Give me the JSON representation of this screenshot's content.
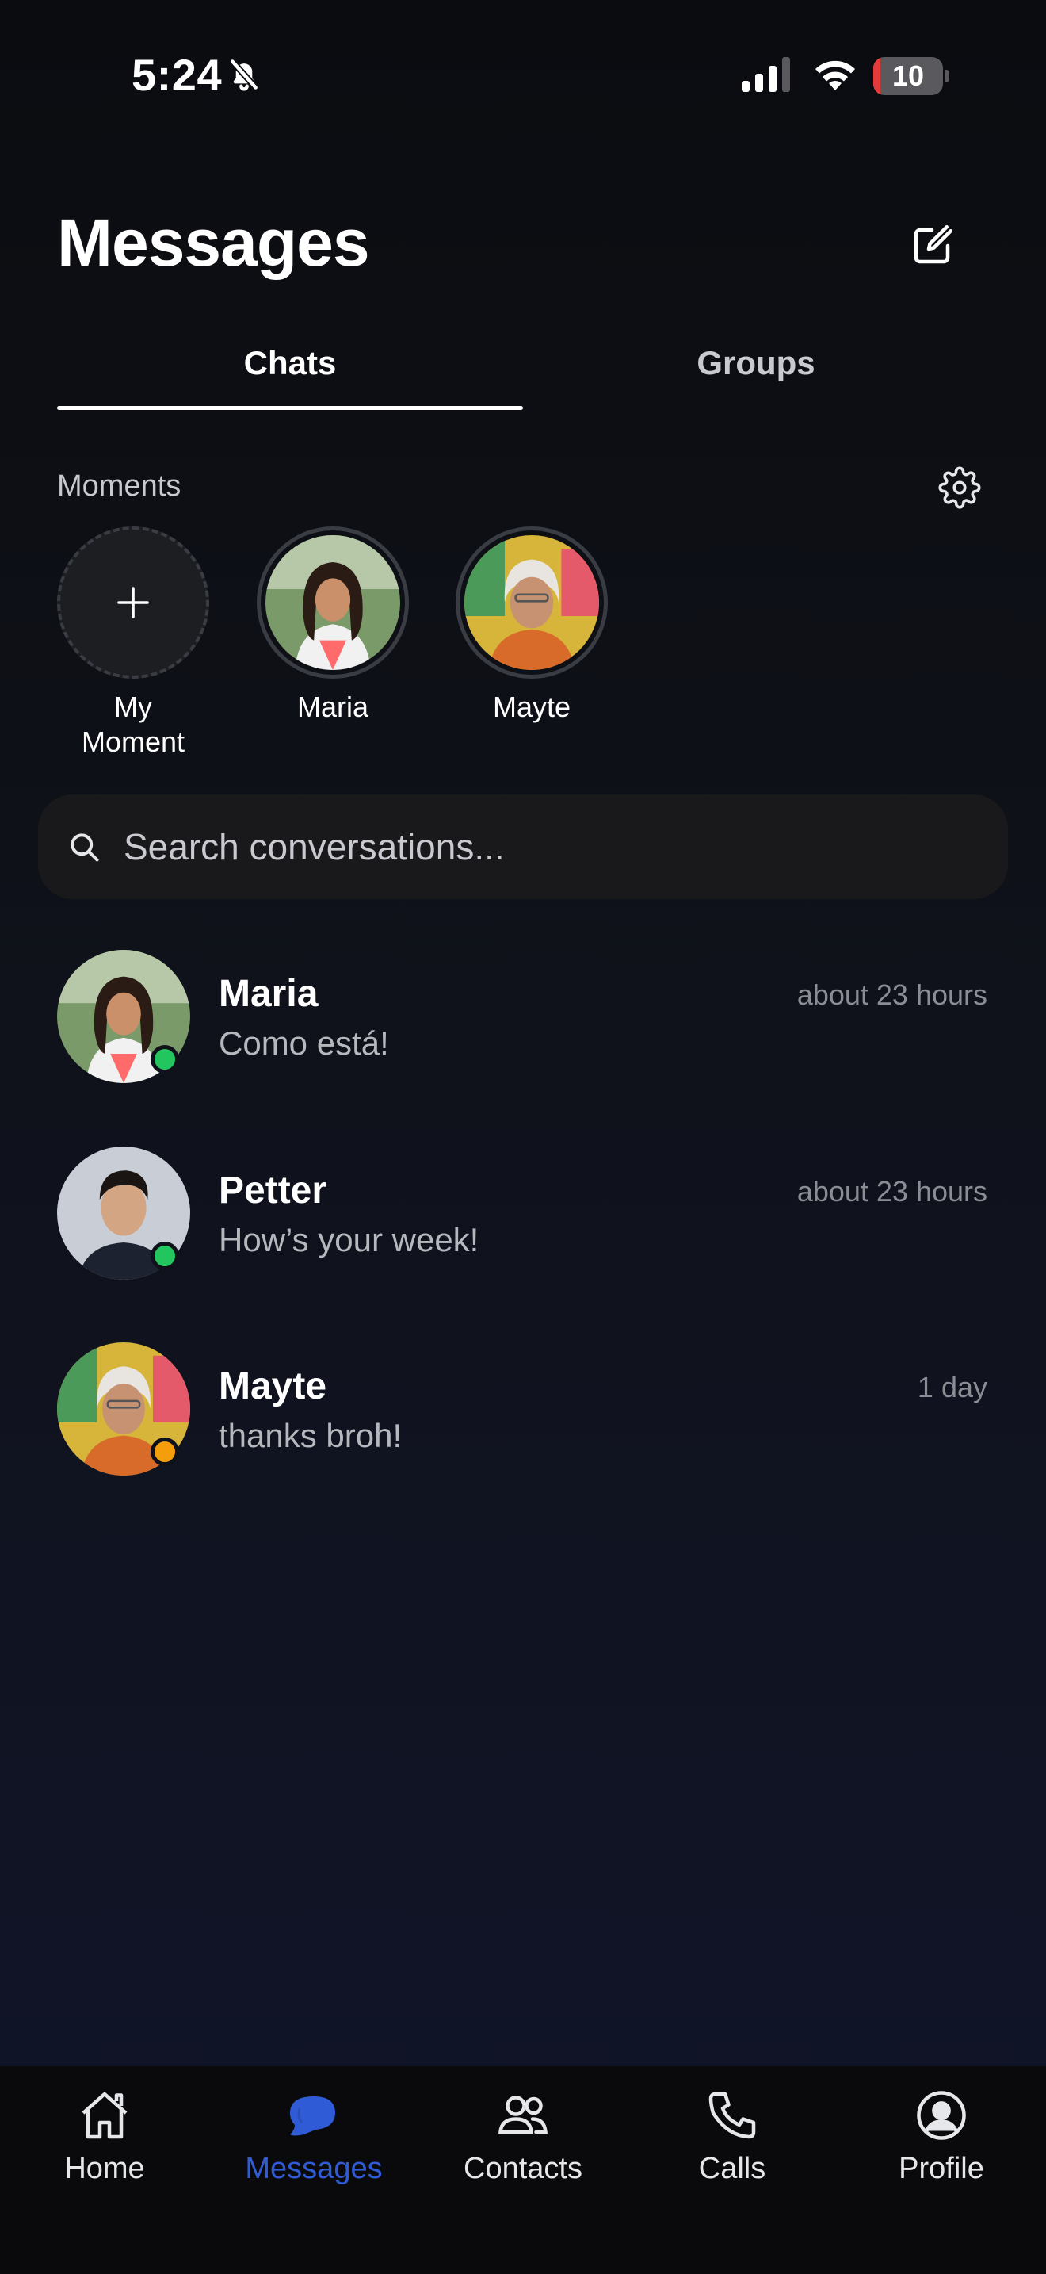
{
  "status_bar": {
    "time": "5:24",
    "battery_level": "10",
    "battery_fraction": 0.1
  },
  "header": {
    "title": "Messages",
    "compose_icon": "compose-icon"
  },
  "tabs": [
    {
      "label": "Chats",
      "active": true
    },
    {
      "label": "Groups",
      "active": false
    }
  ],
  "moments": {
    "label": "Moments",
    "settings_icon": "gear-icon",
    "items": [
      {
        "name": "My\nMoment",
        "type": "add"
      },
      {
        "name": "Maria",
        "type": "avatar"
      },
      {
        "name": "Mayte",
        "type": "avatar"
      }
    ]
  },
  "search": {
    "placeholder": "Search conversations..."
  },
  "conversations": [
    {
      "name": "Maria",
      "message": "Como está!",
      "time": "about 23 hours",
      "status": "online",
      "status_color": "#22c55e"
    },
    {
      "name": "Petter",
      "message": "How’s your week!",
      "time": "about 23 hours",
      "status": "online",
      "status_color": "#22c55e"
    },
    {
      "name": "Mayte",
      "message": "thanks broh!",
      "time": "1 day",
      "status": "away",
      "status_color": "#f59e0b"
    }
  ],
  "bottom_nav": [
    {
      "label": "Home",
      "icon": "home-icon",
      "active": false
    },
    {
      "label": "Messages",
      "icon": "chat-bubble-icon",
      "active": true
    },
    {
      "label": "Contacts",
      "icon": "contacts-icon",
      "active": false
    },
    {
      "label": "Calls",
      "icon": "phone-icon",
      "active": false
    },
    {
      "label": "Profile",
      "icon": "profile-icon",
      "active": false
    }
  ],
  "colors": {
    "accent": "#2f5bd6",
    "background": "#0f121a",
    "online": "#22c55e",
    "away": "#f59e0b",
    "battery_low": "#e5393a"
  }
}
